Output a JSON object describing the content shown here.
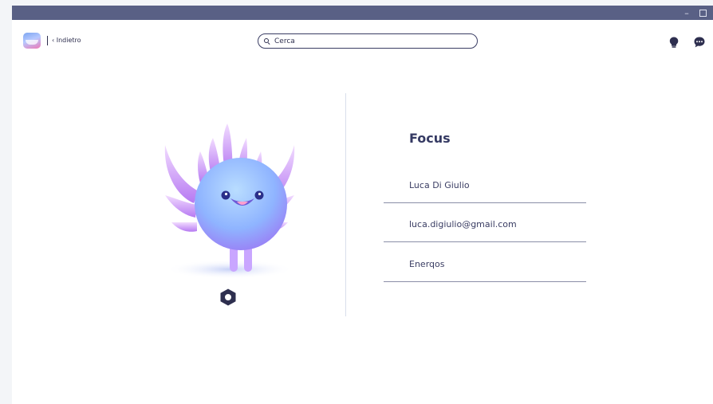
{
  "window": {
    "minimize_glyph": "–",
    "maximize_label": "maximize"
  },
  "header": {
    "back_label": "‹ Indietro",
    "search": {
      "placeholder": "Cerca",
      "value": ""
    },
    "icons": [
      "lightbulb-icon",
      "chat-bubble-icon"
    ]
  },
  "profile": {
    "avatar": "monster-mascot",
    "settings_icon": "gear-icon"
  },
  "panel": {
    "title": "Focus",
    "fields": [
      {
        "value": "Luca Di Giulio"
      },
      {
        "value": "luca.digiulio@gmail.com"
      },
      {
        "value": "Enerqos"
      }
    ]
  },
  "colors": {
    "titlebar": "#596085",
    "accent": "#353a63",
    "mascot_body": "#8fb4ff",
    "mascot_spikes": "#d4a3ff"
  }
}
